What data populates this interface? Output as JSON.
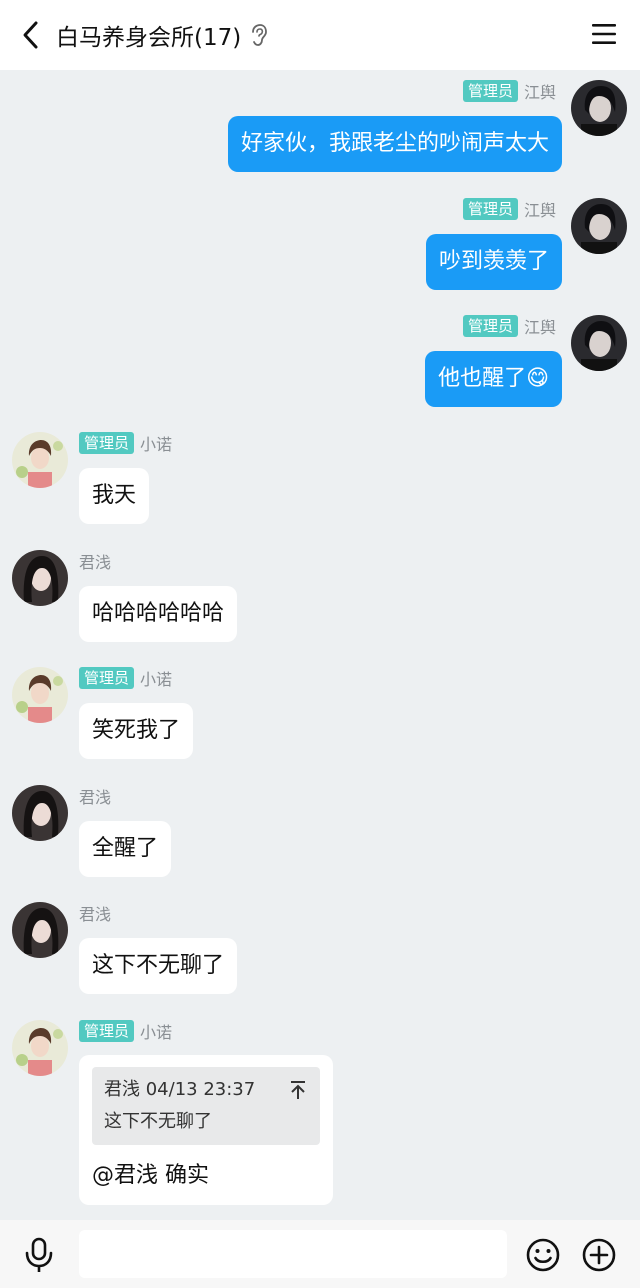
{
  "header": {
    "title": "白马养身会所(17)",
    "back_icon": "chevron-left-icon",
    "ear_icon": "ear-icon",
    "menu_icon": "hamburger-menu-icon"
  },
  "messages": [
    {
      "side": "out",
      "badge": "管理员",
      "sender": "江舆",
      "text": "好家伙，我跟老尘的吵闹声太大",
      "avatar": "dark-hair-avatar"
    },
    {
      "side": "out",
      "badge": "管理员",
      "sender": "江舆",
      "text": "吵到羡羡了",
      "avatar": "dark-hair-avatar"
    },
    {
      "side": "out",
      "badge": "管理员",
      "sender": "江舆",
      "text": "他也醒了😋",
      "avatar": "dark-hair-avatar"
    },
    {
      "side": "in",
      "badge": "管理员",
      "sender": "小诺",
      "text": "我天",
      "avatar": "girl-flowers-avatar"
    },
    {
      "side": "in",
      "badge": "",
      "sender": "君浅",
      "text": "哈哈哈哈哈哈",
      "avatar": "long-hair-avatar"
    },
    {
      "side": "in",
      "badge": "管理员",
      "sender": "小诺",
      "text": "笑死我了",
      "avatar": "girl-flowers-avatar"
    },
    {
      "side": "in",
      "badge": "",
      "sender": "君浅",
      "text": "全醒了",
      "avatar": "long-hair-avatar"
    },
    {
      "side": "in",
      "badge": "",
      "sender": "君浅",
      "text": "这下不无聊了",
      "avatar": "long-hair-avatar"
    },
    {
      "side": "in",
      "badge": "管理员",
      "sender": "小诺",
      "avatar": "girl-flowers-avatar",
      "quote": {
        "header": "君浅 04/13 23:37",
        "text": "这下不无聊了"
      },
      "text": "@君浅 确实"
    }
  ],
  "input": {
    "placeholder": ""
  },
  "toolbar": {
    "mic_icon": "microphone-icon",
    "emoji_icon": "smiley-icon",
    "plus_icon": "plus-circle-icon"
  },
  "colors": {
    "outgoing_bubble": "#1a9bf6",
    "admin_badge": "#52c9c1",
    "chat_bg": "#edf0f2"
  }
}
